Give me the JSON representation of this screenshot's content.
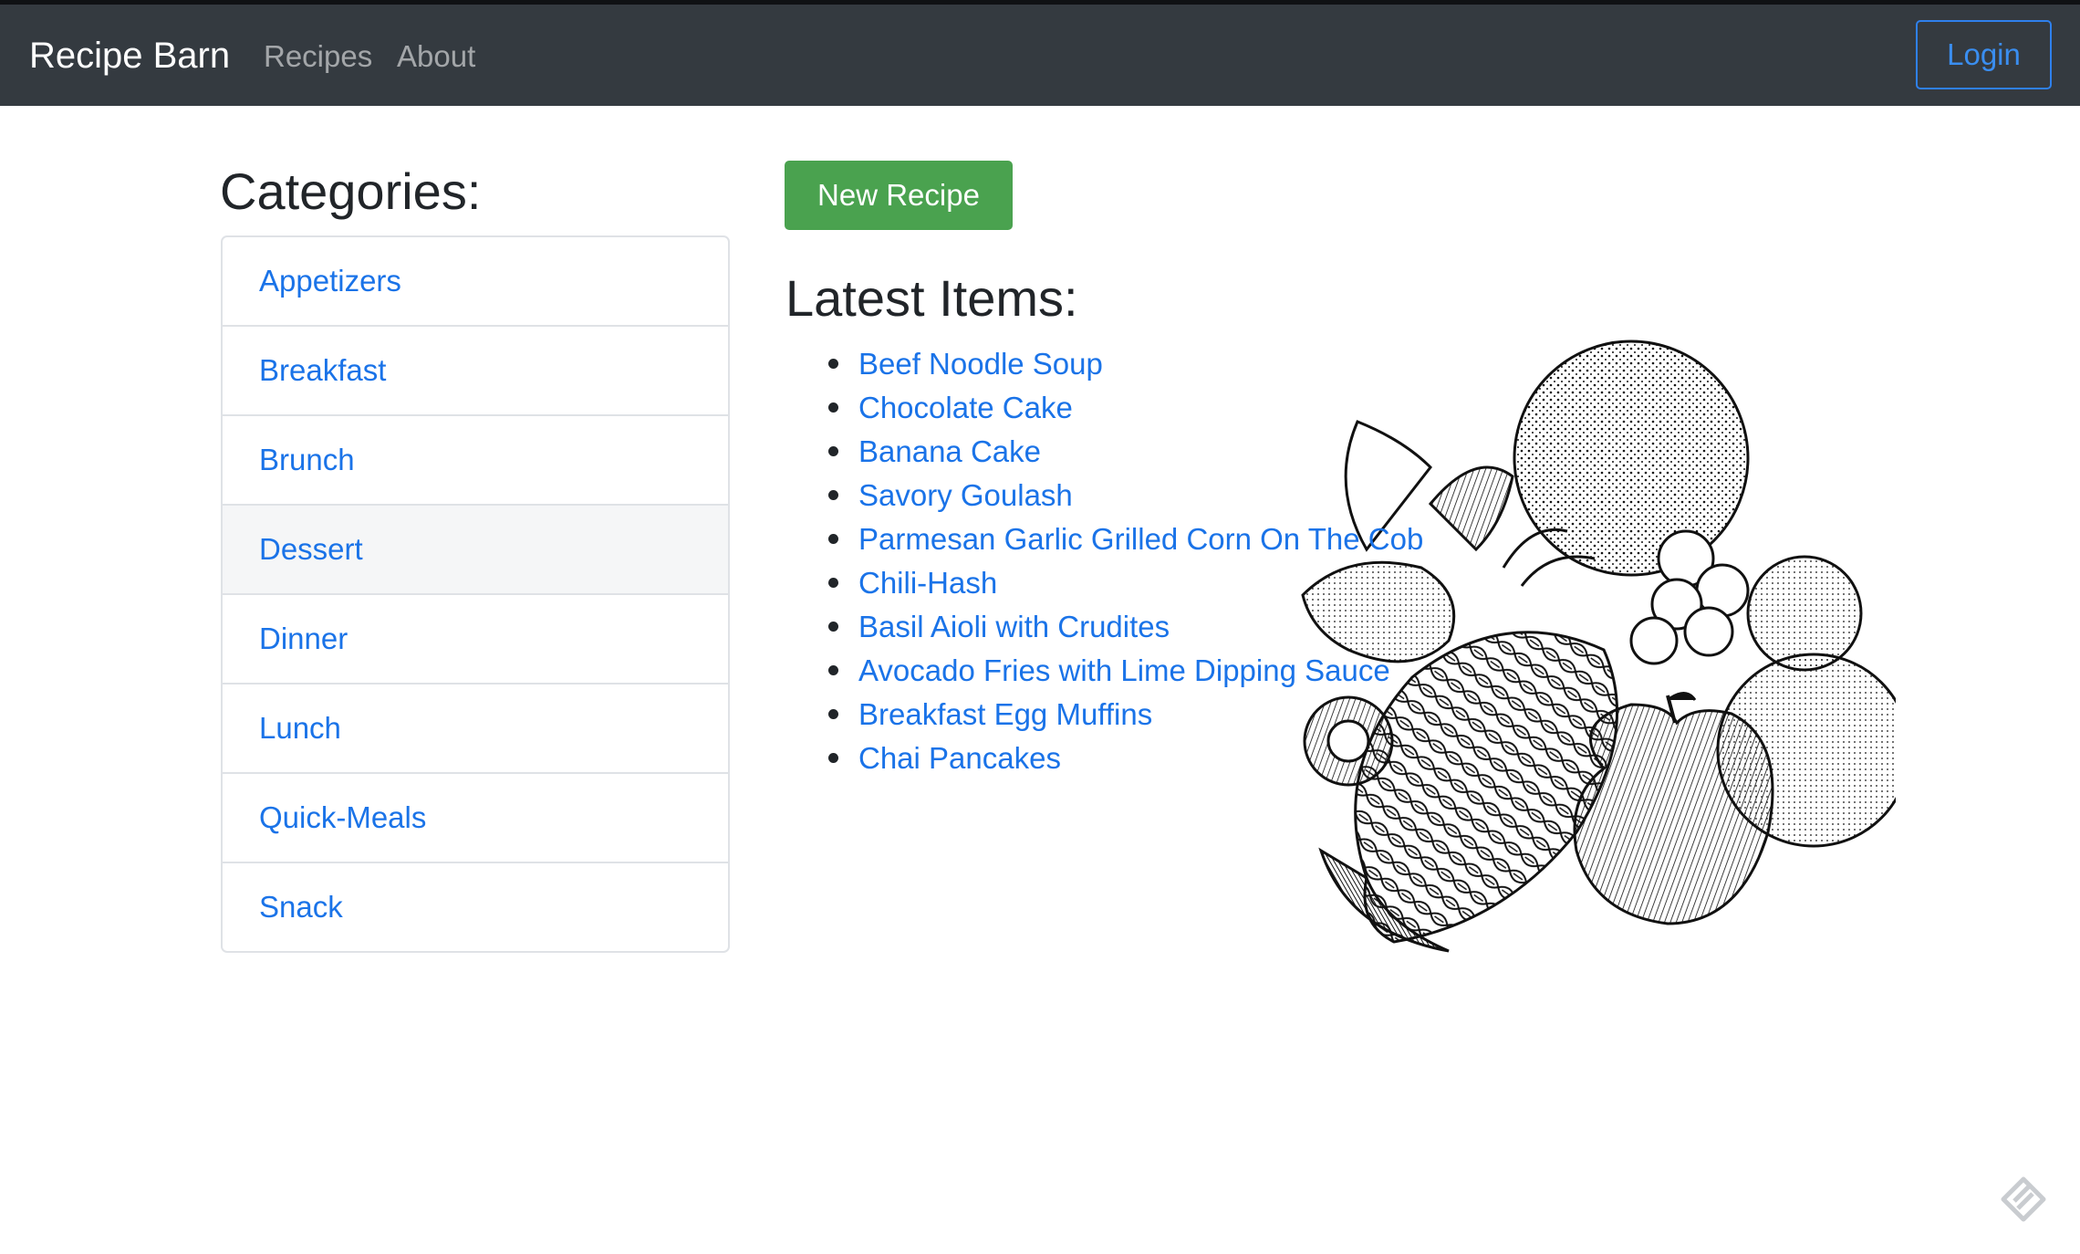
{
  "navbar": {
    "brand": "Recipe Barn",
    "links": [
      "Recipes",
      "About"
    ],
    "login_label": "Login"
  },
  "sidebar": {
    "heading": "Categories:",
    "items": [
      {
        "label": "Appetizers"
      },
      {
        "label": "Breakfast"
      },
      {
        "label": "Brunch"
      },
      {
        "label": "Dessert",
        "active": true
      },
      {
        "label": "Dinner"
      },
      {
        "label": "Lunch"
      },
      {
        "label": "Quick-Meals"
      },
      {
        "label": "Snack"
      }
    ]
  },
  "main": {
    "new_recipe_label": "New Recipe",
    "latest_heading": "Latest Items:",
    "latest_items": [
      "Beef Noodle Soup",
      "Chocolate Cake",
      "Banana Cake",
      "Savory Goulash",
      "Parmesan Garlic Grilled Corn On The Cob",
      "Chili-Hash",
      "Basil Aioli with Crudites",
      "Avocado Fries with Lime Dipping Sauce",
      "Breakfast Egg Muffins",
      "Chai Pancakes"
    ],
    "illustration_icon": "fruit-illustration"
  },
  "corner_icon": "pencil-logo-icon",
  "colors": {
    "navbar_bg": "#343a40",
    "link": "#1a73e8",
    "success": "#4aa24f",
    "login_border": "#2f80ed"
  }
}
